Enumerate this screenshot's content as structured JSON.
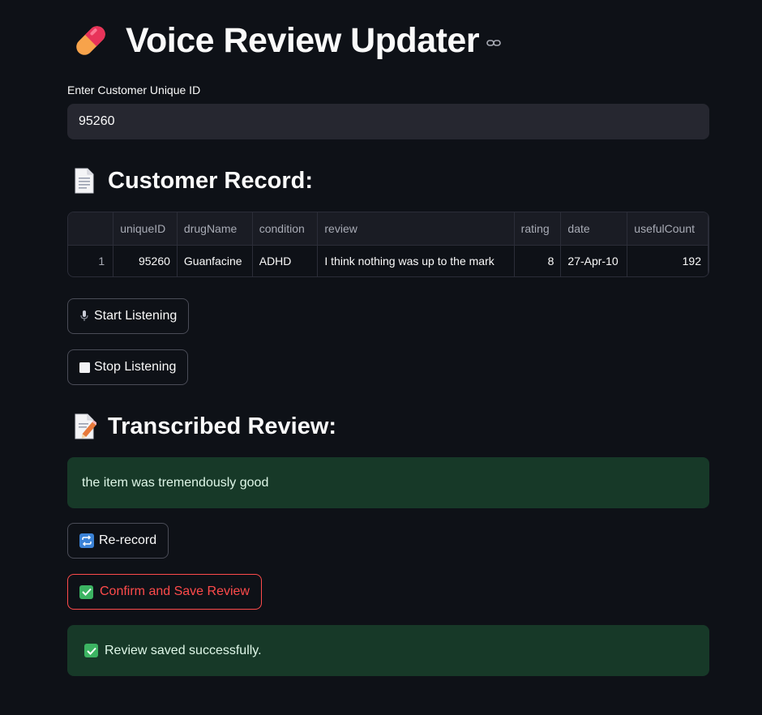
{
  "app": {
    "title": "Voice Review Updater",
    "title_icon": "pill-icon",
    "title_link_icon": "link-icon"
  },
  "input": {
    "label": "Enter Customer Unique ID",
    "value": "95260"
  },
  "customer_section": {
    "header": "Customer Record:",
    "icon": "document-icon"
  },
  "table": {
    "columns": [
      "",
      "uniqueID",
      "drugName",
      "condition",
      "review",
      "rating",
      "date",
      "usefulCount"
    ],
    "rows": [
      [
        "1",
        "95260",
        "Guanfacine",
        "ADHD",
        "I think nothing was up to the mark",
        "8",
        "27-Apr-10",
        "192"
      ]
    ]
  },
  "buttons": {
    "start_listening": "Start Listening",
    "stop_listening": "Stop Listening",
    "rerecord": "Re-record",
    "confirm_save": "Confirm and Save Review"
  },
  "transcribed_section": {
    "header": "Transcribed Review:",
    "icon": "memo-icon",
    "text": "the item was tremendously good"
  },
  "status": {
    "message": "Review saved successfully."
  },
  "colors": {
    "background": "#0e1117",
    "input_bg": "#262730",
    "success_bg": "#173928",
    "accent_red": "#ff4b4b"
  }
}
